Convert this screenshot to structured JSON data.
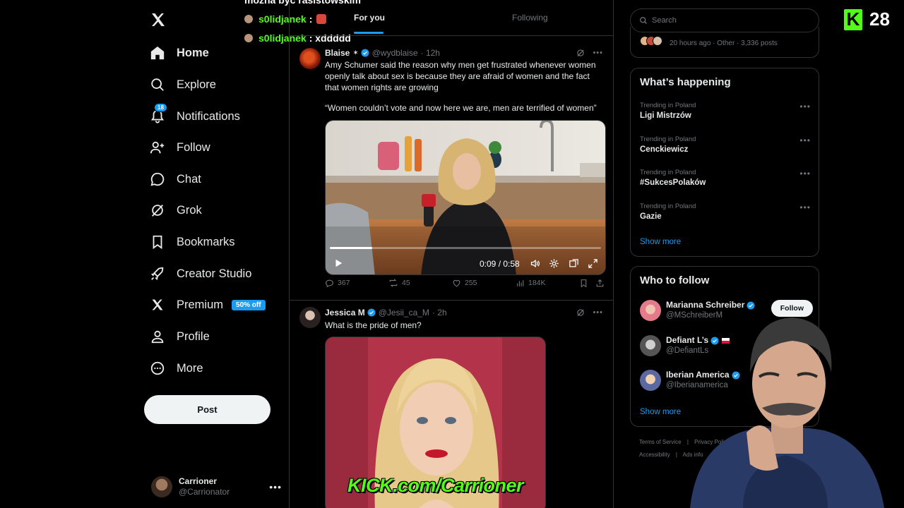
{
  "stream_chat": {
    "top_partial": "można być rasistowskim",
    "lines": [
      {
        "user": "s0lidjanek",
        "msg": ":"
      },
      {
        "user": "s0lidjanek",
        "msg": ": xddddd"
      }
    ]
  },
  "nav": {
    "items": [
      {
        "label": "Home",
        "icon": "home-icon"
      },
      {
        "label": "Explore",
        "icon": "search-icon"
      },
      {
        "label": "Notifications",
        "icon": "bell-icon",
        "badge": "18"
      },
      {
        "label": "Follow",
        "icon": "person-plus-icon"
      },
      {
        "label": "Chat",
        "icon": "chat-bubble-icon"
      },
      {
        "label": "Grok",
        "icon": "grok-icon"
      },
      {
        "label": "Bookmarks",
        "icon": "bookmark-icon"
      },
      {
        "label": "Creator Studio",
        "icon": "rocket-icon"
      },
      {
        "label": "Premium",
        "icon": "x-logo-icon",
        "promo": "50% off"
      },
      {
        "label": "Profile",
        "icon": "person-icon"
      },
      {
        "label": "More",
        "icon": "more-circle-icon"
      }
    ],
    "post_label": "Post",
    "account": {
      "name": "Carrioner",
      "handle": "@Carrionator"
    }
  },
  "tabs": {
    "for_you": "For you",
    "following": "Following"
  },
  "tweets": [
    {
      "name": "Blaise",
      "handle": "@wydblaise",
      "time": "· 12h",
      "text1": "Amy Schumer said the reason why men get frustrated whenever women openly talk about sex is because they are afraid of women and the fact that women rights are growing",
      "text2": "“Women couldn’t vote and now here we are, men are terrified of women”",
      "video_time": "0:09 / 0:58",
      "video_progress": 0.155,
      "replies": "367",
      "reposts": "45",
      "likes": "255",
      "views": "184K"
    },
    {
      "name": "Jessica M",
      "handle": "@Jesii_ca_M",
      "time": "· 2h",
      "text1": "What is the pride of men?"
    }
  ],
  "search": {
    "placeholder": "Search"
  },
  "partial_card": {
    "meta": "20 hours ago · Other · 3,336 posts"
  },
  "happening": {
    "title": "What’s happening",
    "trends": [
      {
        "context": "Trending in Poland",
        "topic": "Ligi Mistrzów"
      },
      {
        "context": "Trending in Poland",
        "topic": "Cenckiewicz"
      },
      {
        "context": "Trending in Poland",
        "topic": "#SukcesPolaków"
      },
      {
        "context": "Trending in Poland",
        "topic": "Gazie"
      }
    ],
    "show_more": "Show more"
  },
  "who_to_follow": {
    "title": "Who to follow",
    "users": [
      {
        "name": "Marianna Schreiber",
        "handle": "@MSchreiberM",
        "button": "Follow"
      },
      {
        "name": "Defiant L’s",
        "handle": "@DefiantLs"
      },
      {
        "name": "Iberian America",
        "handle": "@Iberianamerica"
      }
    ],
    "show_more": "Show more"
  },
  "footer": {
    "tos": "Terms of Service",
    "privacy": "Privacy Policy",
    "accessibility": "Accessibility",
    "ads": "Ads info"
  },
  "overlay": {
    "viewer_count": "28",
    "kick_url": "KICK.com/Carrioner"
  },
  "colors": {
    "accent": "#1d9bf0",
    "kick_green": "#53fc18",
    "background": "#000000",
    "border": "#2f3336",
    "muted": "#71767b"
  }
}
